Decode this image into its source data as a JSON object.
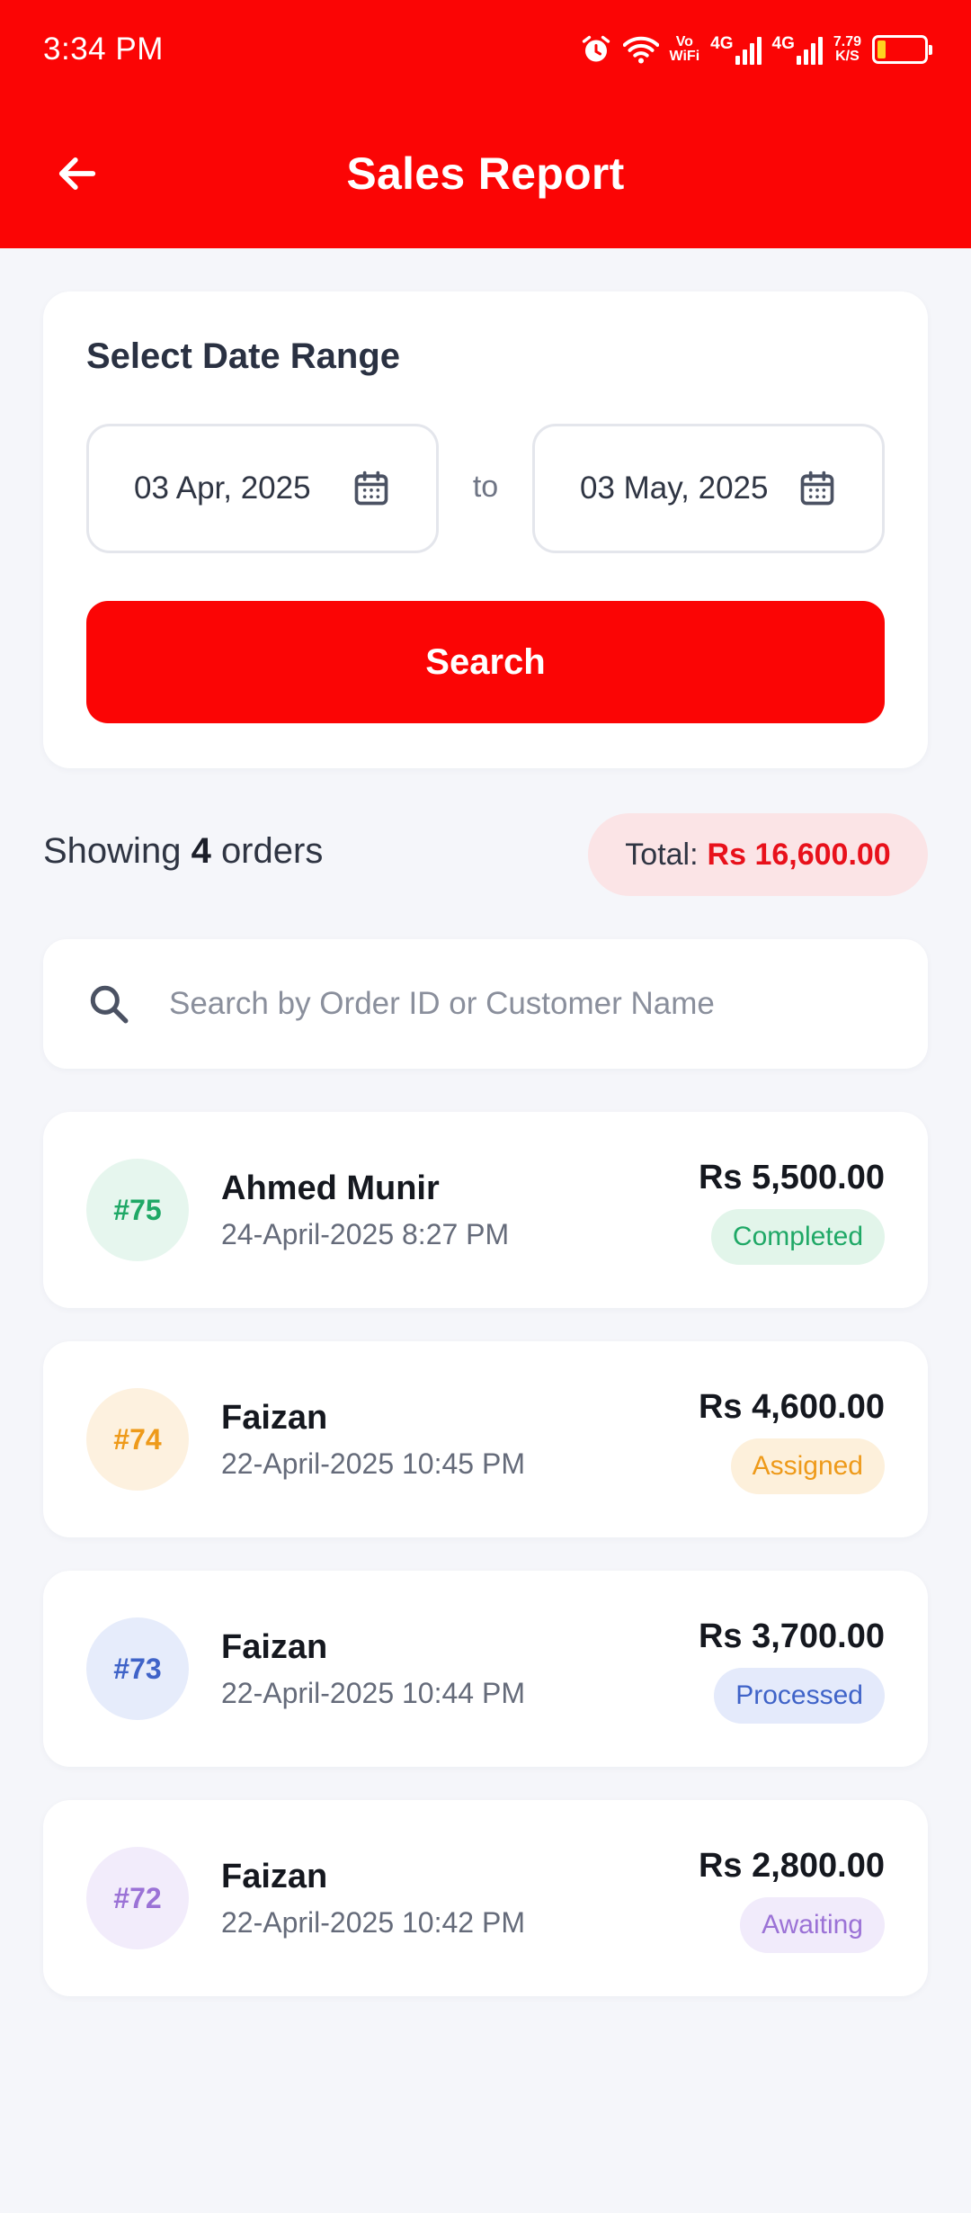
{
  "status_bar": {
    "time": "3:34 PM",
    "vowifi_top": "Vo",
    "vowifi_bottom": "WiFi",
    "network_1": "4G",
    "network_2": "4G",
    "speed_value": "7.79",
    "speed_unit": "K/S",
    "battery_level": 0.18,
    "battery_color": "#ffd21f",
    "icons": [
      "alarm-icon",
      "wifi-icon",
      "signal-icon",
      "battery-icon"
    ]
  },
  "header": {
    "title": "Sales Report",
    "back_icon": "arrow-left-icon",
    "background": "#fb0505"
  },
  "date_range": {
    "title": "Select Date Range",
    "from": "03 Apr, 2025",
    "separator": "to",
    "to": "03 May, 2025",
    "calendar_icon": "calendar-icon",
    "search_label": "Search"
  },
  "summary": {
    "showing_prefix": "Showing",
    "count": "4",
    "showing_suffix": "orders",
    "total_label": "Total:",
    "total_value": "Rs 16,600.00"
  },
  "search": {
    "placeholder": "Search by Order ID or Customer Name",
    "value": ""
  },
  "orders": [
    {
      "id": "#75",
      "name": "Ahmed Munir",
      "date": "24-April-2025 8:27 PM",
      "amount": "Rs 5,500.00",
      "status": "Completed",
      "badge_bg": "#e6f6ee",
      "badge_fg": "#1fa866",
      "status_bg": "#e2f5ea",
      "status_fg": "#1fa866"
    },
    {
      "id": "#74",
      "name": "Faizan",
      "date": "22-April-2025 10:45 PM",
      "amount": "Rs 4,600.00",
      "status": "Assigned",
      "badge_bg": "#fdf1df",
      "badge_fg": "#ee9a1a",
      "status_bg": "#fdf0db",
      "status_fg": "#ee9a1a"
    },
    {
      "id": "#73",
      "name": "Faizan",
      "date": "22-April-2025 10:44 PM",
      "amount": "Rs 3,700.00",
      "status": "Processed",
      "badge_bg": "#e6ecfb",
      "badge_fg": "#3f63c8",
      "status_bg": "#e4eafb",
      "status_fg": "#3f63c8"
    },
    {
      "id": "#72",
      "name": "Faizan",
      "date": "22-April-2025 10:42 PM",
      "amount": "Rs 2,800.00",
      "status": "Awaiting",
      "badge_bg": "#f2ecfb",
      "badge_fg": "#9b72d6",
      "status_bg": "#f1ebfb",
      "status_fg": "#9b72d6"
    }
  ]
}
